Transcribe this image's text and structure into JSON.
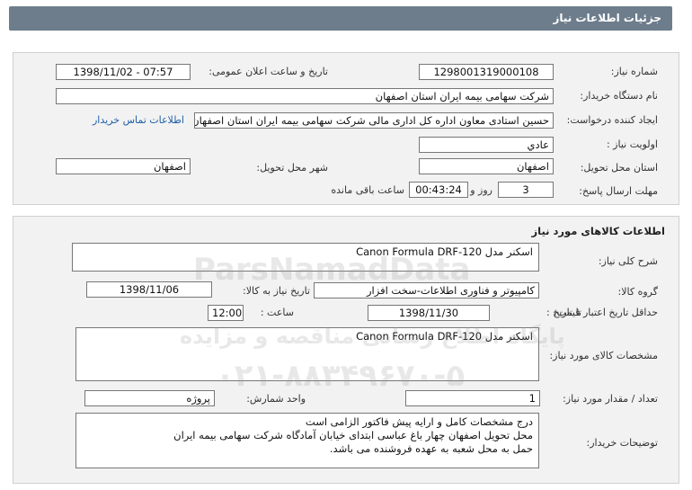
{
  "header": {
    "title": "جزئیات اطلاعات نیاز"
  },
  "need_info": {
    "need_number_label": "شماره نیاز:",
    "need_number": "1298001319000108",
    "announce_label": "تاریخ و ساعت اعلان عمومی:",
    "announce_value": "1398/11/02 - 07:57",
    "buyer_org_label": "نام دستگاه خریدار:",
    "buyer_org": "شرکت سهامی بیمه ایران استان اصفهان",
    "creator_label": "ایجاد کننده درخواست:",
    "creator": "حسین استادی معاون اداره کل اداری مالی شرکت سهامی بیمه ایران استان اصفهان",
    "contact_link": "اطلاعات تماس خریدار",
    "priority_label": "اولویت نیاز :",
    "priority": "عادي",
    "province_label": "استان محل تحویل:",
    "province": "اصفهان",
    "city_label": "شهر محل تحویل:",
    "city": "اصفهان",
    "deadline_label": "مهلت ارسال پاسخ:",
    "days_value": "3",
    "days_unit": "روز و",
    "time_value": "00:43:24",
    "time_unit": "ساعت باقی مانده"
  },
  "goods": {
    "section_title": "اطلاعات کالاهای مورد نیاز",
    "summary_label": "شرح کلی نیاز:",
    "summary": "اسکنر مدل Canon Formula DRF-120",
    "group_label": "گروه کالا:",
    "group": "کامپیوتر و فناوری اطلاعات-سخت افزار",
    "need_date_label": "تاریخ نیاز به کالا:",
    "need_date": "1398/11/06",
    "validity_label": "حداقل تاریخ اعتبار قیمت:",
    "until_label": "تا تاریخ :",
    "validity_date": "1398/11/30",
    "hour_label": "ساعت :",
    "validity_hour": "12:00",
    "specs_label": "مشخصات کالای مورد نیاز:",
    "specs": "اسکنر مدل Canon Formula DRF-120",
    "qty_label": "تعداد / مقدار مورد نیاز:",
    "qty": "1",
    "unit_label": "واحد شمارش:",
    "unit": "پروژه",
    "buyer_notes_label": "توضیحات خریدار:",
    "buyer_notes_lines": [
      "درج مشخصات کامل و ارایه پیش فاکتور الزامی است",
      "محل تحویل اصفهان چهار باغ عباسی ابتدای خیابان آمادگاه شرکت سهامی بیمه ایران",
      "حمل به محل شعبه به عهده فروشنده می باشد."
    ]
  },
  "watermark": {
    "line1": "ParsNamadData",
    "line2": "پایگاه اطلاع رسانی مناقصه و مزایده",
    "line3": "۰۲۱-۸۸۳۴۹۶۷۰-۵"
  }
}
